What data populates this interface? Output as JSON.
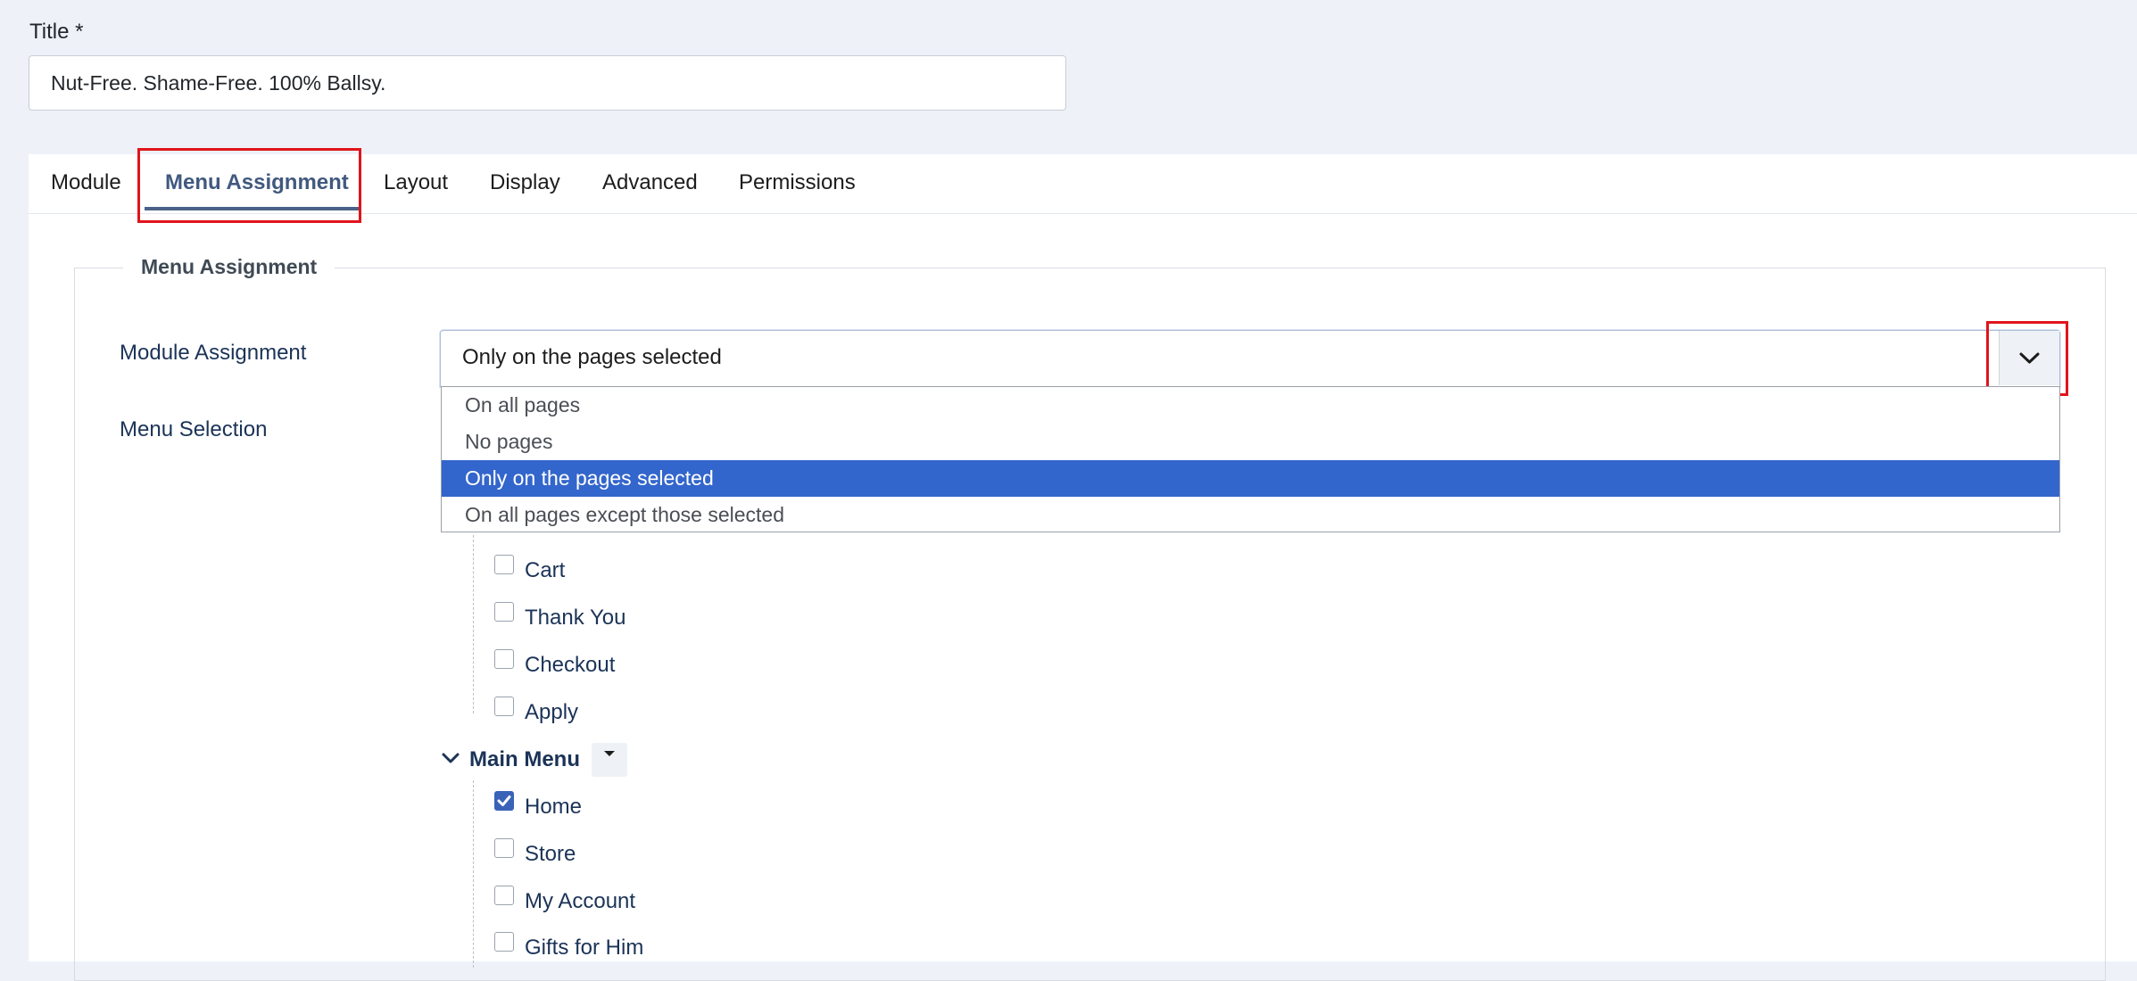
{
  "title_field": {
    "label": "Title *",
    "value": "Nut-Free. Shame-Free. 100% Ballsy."
  },
  "tabs": [
    {
      "label": "Module"
    },
    {
      "label": "Menu Assignment"
    },
    {
      "label": "Layout"
    },
    {
      "label": "Display"
    },
    {
      "label": "Advanced"
    },
    {
      "label": "Permissions"
    }
  ],
  "active_tab": "Menu Assignment",
  "fieldset": {
    "legend": "Menu Assignment"
  },
  "module_assignment": {
    "label": "Module Assignment",
    "selected": "Only on the pages selected",
    "options": [
      "On all pages",
      "No pages",
      "Only on the pages selected",
      "On all pages except those selected"
    ]
  },
  "menu_selection": {
    "label": "Menu Selection",
    "first_group_items": [
      {
        "label": "Cart",
        "checked": false
      },
      {
        "label": "Thank You",
        "checked": false
      },
      {
        "label": "Checkout",
        "checked": false
      },
      {
        "label": "Apply",
        "checked": false
      }
    ],
    "main_menu": {
      "label": "Main Menu",
      "items": [
        {
          "label": "Home",
          "checked": true
        },
        {
          "label": "Store",
          "checked": false
        },
        {
          "label": "My Account",
          "checked": false
        },
        {
          "label": "Gifts for Him",
          "checked": false
        }
      ]
    }
  },
  "colors": {
    "accent": "#3366cc",
    "highlight": "#e1141b",
    "tab_active": "#41597f"
  }
}
